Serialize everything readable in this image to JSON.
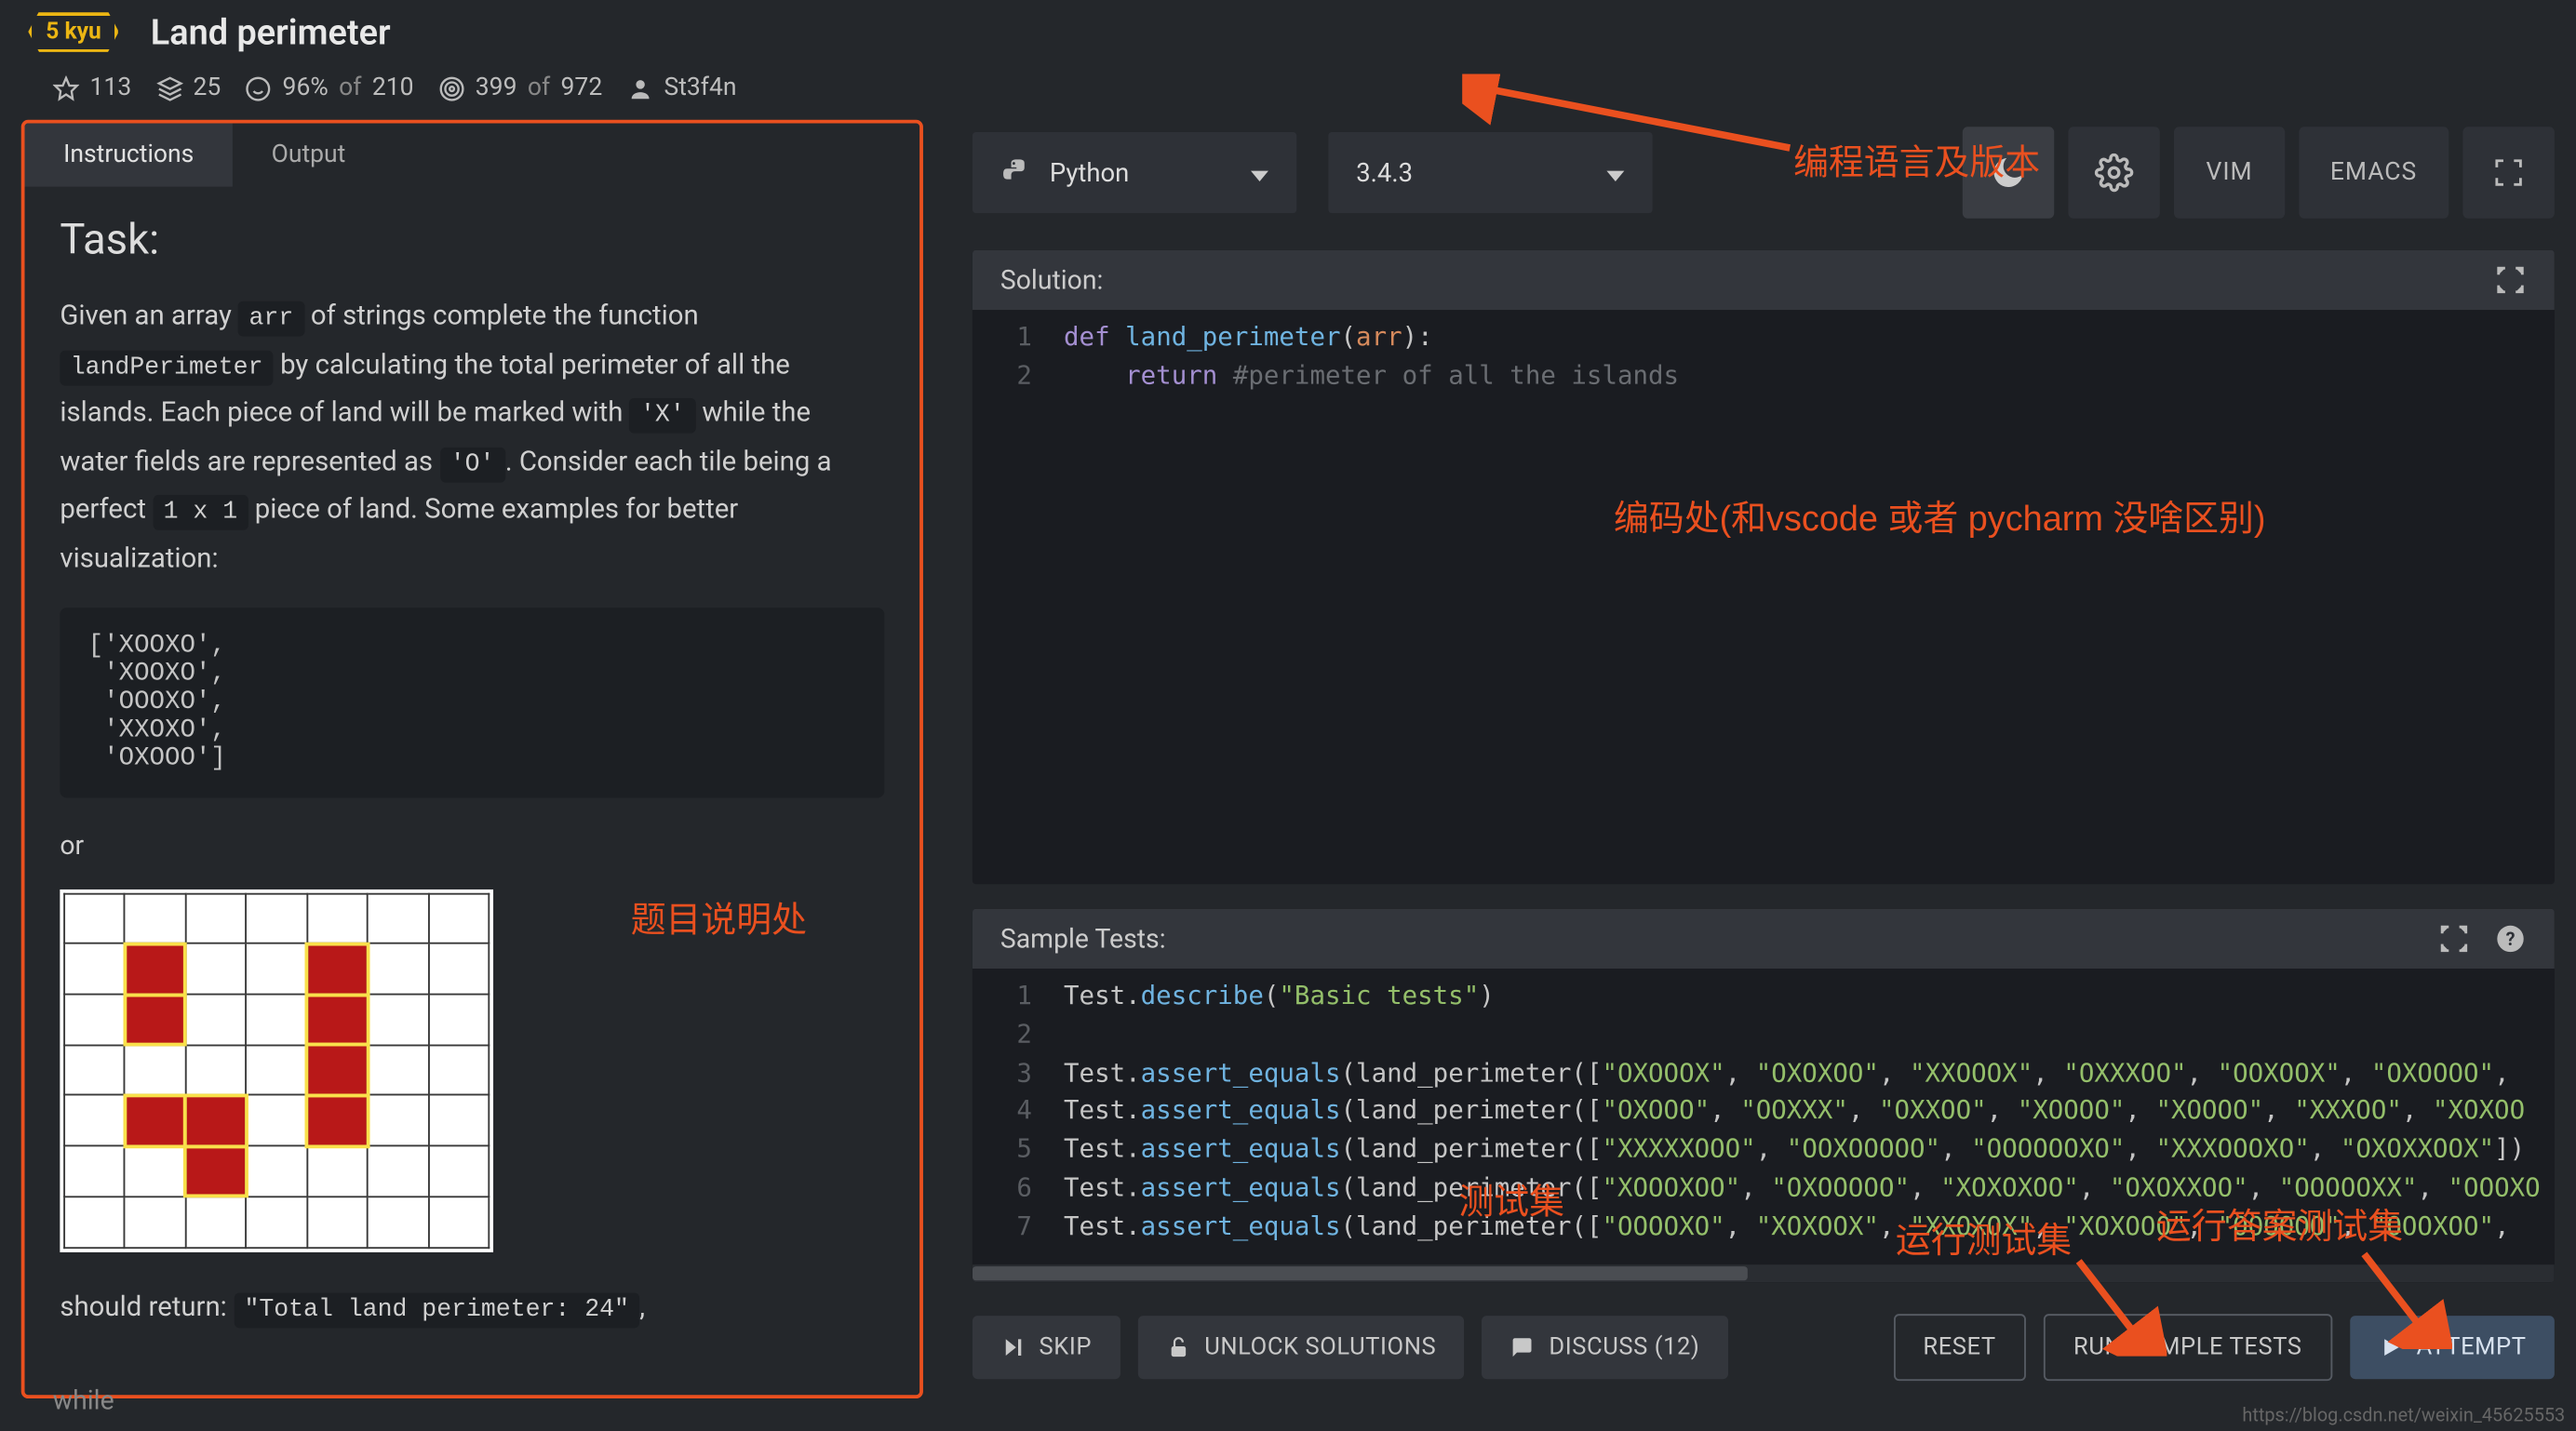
{
  "header": {
    "kyu_label": "5 kyu",
    "title": "Land perimeter"
  },
  "stats": {
    "favorites": "113",
    "stacks": "25",
    "satisfaction_pct": "96%",
    "satisfaction_of": "of",
    "satisfaction_total": "210",
    "completions": "399",
    "completions_of": "of",
    "completions_total": "972",
    "author": "St3f4n"
  },
  "tabs": {
    "instructions": "Instructions",
    "output": "Output"
  },
  "description": {
    "task_heading": "Task:",
    "p1_before_arr": "Given an array ",
    "code_arr": "arr",
    "p1_mid": " of strings complete the function ",
    "code_lp": "landPerimeter",
    "p1_after": " by calculating the total perimeter of all the islands. Each piece of land will be marked with ",
    "code_x": "'X'",
    "p1_mid2": " while the water fields are represented as ",
    "code_o": "'O'",
    "p1_tail": ". Consider each tile being a perfect ",
    "code_1x1": "1 x 1",
    "p1_end": " piece of land. Some examples for better visualization:",
    "example_block": "['XOOXO',\n 'XOOXO',\n 'OOOXO',\n 'XXOXO',\n 'OXOOO']",
    "or": "or",
    "should_return": "should return: ",
    "result_str": "\"Total land perimeter: 24\"",
    "trailing": ","
  },
  "while_word": "while",
  "right": {
    "language": "Python",
    "version": "3.4.3",
    "vim": "VIM",
    "emacs": "EMACS"
  },
  "solution_panel": {
    "title": "Solution:"
  },
  "solution_code": {
    "line_numbers": "1\n2",
    "line1_kw": "def",
    "line1_fn": "land_perimeter",
    "line1_paren_open": "(",
    "line1_arg": "arr",
    "line1_after": "):",
    "line2_kw": "return",
    "line2_cmt": "#perimeter of all the islands"
  },
  "tests_panel": {
    "title": "Sample Tests:"
  },
  "tests_code": {
    "line_numbers": "1\n2\n3\n4\n5\n6\n7",
    "body_html": "Test.<span class='tok-fn'>describe</span>(<span class='tok-str'>\"Basic tests\"</span>)\n\nTest.<span class='tok-fn'>assert_equals</span>(land_perimeter([<span class='tok-str'>\"OXOOOX\"</span>, <span class='tok-str'>\"OXOXOO\"</span>, <span class='tok-str'>\"XXOOOX\"</span>, <span class='tok-str'>\"OXXXOO\"</span>, <span class='tok-str'>\"OOXOOX\"</span>, <span class='tok-str'>\"OXOOOO\"</span>,\nTest.<span class='tok-fn'>assert_equals</span>(land_perimeter([<span class='tok-str'>\"OXOOO\"</span>, <span class='tok-str'>\"OOXXX\"</span>, <span class='tok-str'>\"OXXOO\"</span>, <span class='tok-str'>\"XOOOO\"</span>, <span class='tok-str'>\"XOOOO\"</span>, <span class='tok-str'>\"XXXOO\"</span>, <span class='tok-str'>\"XOXOO</span>\nTest.<span class='tok-fn'>assert_equals</span>(land_perimeter([<span class='tok-str'>\"XXXXXOOO\"</span>, <span class='tok-str'>\"OOXOOOOO\"</span>, <span class='tok-str'>\"OOOOOOXO\"</span>, <span class='tok-str'>\"XXXOOOXO\"</span>, <span class='tok-str'>\"OXOXXOOX\"</span>])\nTest.<span class='tok-fn'>assert_equals</span>(land_perimeter([<span class='tok-str'>\"XOOOXOO\"</span>, <span class='tok-str'>\"OXOOOOO\"</span>, <span class='tok-str'>\"XOXOXOO\"</span>, <span class='tok-str'>\"OXOXXOO\"</span>, <span class='tok-str'>\"OOOOOXX\"</span>, <span class='tok-str'>\"OOOXO</span>\nTest.<span class='tok-fn'>assert_equals</span>(land_perimeter([<span class='tok-str'>\"OOOOXO\"</span>, <span class='tok-str'>\"XOXOOX\"</span>, <span class='tok-str'>\"XXOXOX\"</span>, <span class='tok-str'>\"XOXOOO\"</span>, <span class='tok-str'>\"OOOOOO\"</span>, <span class='tok-str'>\"OOOXOO\"</span>,"
  },
  "annotations": {
    "lang_version": "编程语言及版本",
    "desc_area": "题目说明处",
    "editor_area": "编码处(和vscode 或者 pycharm 没啥区别)",
    "tests_area": "测试集",
    "run_tests": "运行测试集",
    "run_answer": "运行答案测试集"
  },
  "buttons": {
    "skip": "SKIP",
    "unlock": "UNLOCK SOLUTIONS",
    "discuss": "DISCUSS (12)",
    "reset": "RESET",
    "run_sample": "RUN SAMPLE TESTS",
    "attempt": "ATTEMPT"
  },
  "watermark": "https://blog.csdn.net/weixin_45625553"
}
